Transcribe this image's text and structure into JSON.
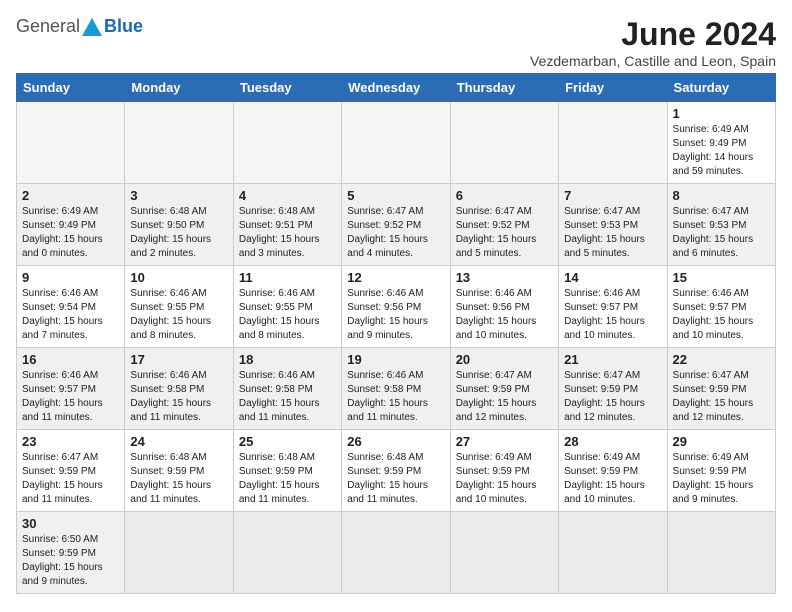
{
  "header": {
    "logo_general": "General",
    "logo_blue": "Blue",
    "month_title": "June 2024",
    "location": "Vezdemarban, Castille and Leon, Spain"
  },
  "weekdays": [
    "Sunday",
    "Monday",
    "Tuesday",
    "Wednesday",
    "Thursday",
    "Friday",
    "Saturday"
  ],
  "weeks": [
    [
      {
        "day": "",
        "info": ""
      },
      {
        "day": "",
        "info": ""
      },
      {
        "day": "",
        "info": ""
      },
      {
        "day": "",
        "info": ""
      },
      {
        "day": "",
        "info": ""
      },
      {
        "day": "",
        "info": ""
      },
      {
        "day": "1",
        "info": "Sunrise: 6:49 AM\nSunset: 9:49 PM\nDaylight: 14 hours\nand 59 minutes."
      }
    ],
    [
      {
        "day": "2",
        "info": "Sunrise: 6:49 AM\nSunset: 9:49 PM\nDaylight: 15 hours\nand 0 minutes."
      },
      {
        "day": "3",
        "info": "Sunrise: 6:48 AM\nSunset: 9:50 PM\nDaylight: 15 hours\nand 2 minutes."
      },
      {
        "day": "4",
        "info": "Sunrise: 6:48 AM\nSunset: 9:51 PM\nDaylight: 15 hours\nand 3 minutes."
      },
      {
        "day": "5",
        "info": "Sunrise: 6:47 AM\nSunset: 9:52 PM\nDaylight: 15 hours\nand 4 minutes."
      },
      {
        "day": "6",
        "info": "Sunrise: 6:47 AM\nSunset: 9:52 PM\nDaylight: 15 hours\nand 5 minutes."
      },
      {
        "day": "7",
        "info": "Sunrise: 6:47 AM\nSunset: 9:53 PM\nDaylight: 15 hours\nand 5 minutes."
      },
      {
        "day": "8",
        "info": "Sunrise: 6:47 AM\nSunset: 9:53 PM\nDaylight: 15 hours\nand 6 minutes."
      }
    ],
    [
      {
        "day": "9",
        "info": "Sunrise: 6:46 AM\nSunset: 9:54 PM\nDaylight: 15 hours\nand 7 minutes."
      },
      {
        "day": "10",
        "info": "Sunrise: 6:46 AM\nSunset: 9:55 PM\nDaylight: 15 hours\nand 8 minutes."
      },
      {
        "day": "11",
        "info": "Sunrise: 6:46 AM\nSunset: 9:55 PM\nDaylight: 15 hours\nand 8 minutes."
      },
      {
        "day": "12",
        "info": "Sunrise: 6:46 AM\nSunset: 9:56 PM\nDaylight: 15 hours\nand 9 minutes."
      },
      {
        "day": "13",
        "info": "Sunrise: 6:46 AM\nSunset: 9:56 PM\nDaylight: 15 hours\nand 10 minutes."
      },
      {
        "day": "14",
        "info": "Sunrise: 6:46 AM\nSunset: 9:57 PM\nDaylight: 15 hours\nand 10 minutes."
      },
      {
        "day": "15",
        "info": "Sunrise: 6:46 AM\nSunset: 9:57 PM\nDaylight: 15 hours\nand 10 minutes."
      }
    ],
    [
      {
        "day": "16",
        "info": "Sunrise: 6:46 AM\nSunset: 9:57 PM\nDaylight: 15 hours\nand 11 minutes."
      },
      {
        "day": "17",
        "info": "Sunrise: 6:46 AM\nSunset: 9:58 PM\nDaylight: 15 hours\nand 11 minutes."
      },
      {
        "day": "18",
        "info": "Sunrise: 6:46 AM\nSunset: 9:58 PM\nDaylight: 15 hours\nand 11 minutes."
      },
      {
        "day": "19",
        "info": "Sunrise: 6:46 AM\nSunset: 9:58 PM\nDaylight: 15 hours\nand 11 minutes."
      },
      {
        "day": "20",
        "info": "Sunrise: 6:47 AM\nSunset: 9:59 PM\nDaylight: 15 hours\nand 12 minutes."
      },
      {
        "day": "21",
        "info": "Sunrise: 6:47 AM\nSunset: 9:59 PM\nDaylight: 15 hours\nand 12 minutes."
      },
      {
        "day": "22",
        "info": "Sunrise: 6:47 AM\nSunset: 9:59 PM\nDaylight: 15 hours\nand 12 minutes."
      }
    ],
    [
      {
        "day": "23",
        "info": "Sunrise: 6:47 AM\nSunset: 9:59 PM\nDaylight: 15 hours\nand 11 minutes."
      },
      {
        "day": "24",
        "info": "Sunrise: 6:48 AM\nSunset: 9:59 PM\nDaylight: 15 hours\nand 11 minutes."
      },
      {
        "day": "25",
        "info": "Sunrise: 6:48 AM\nSunset: 9:59 PM\nDaylight: 15 hours\nand 11 minutes."
      },
      {
        "day": "26",
        "info": "Sunrise: 6:48 AM\nSunset: 9:59 PM\nDaylight: 15 hours\nand 11 minutes."
      },
      {
        "day": "27",
        "info": "Sunrise: 6:49 AM\nSunset: 9:59 PM\nDaylight: 15 hours\nand 10 minutes."
      },
      {
        "day": "28",
        "info": "Sunrise: 6:49 AM\nSunset: 9:59 PM\nDaylight: 15 hours\nand 10 minutes."
      },
      {
        "day": "29",
        "info": "Sunrise: 6:49 AM\nSunset: 9:59 PM\nDaylight: 15 hours\nand 9 minutes."
      }
    ],
    [
      {
        "day": "30",
        "info": "Sunrise: 6:50 AM\nSunset: 9:59 PM\nDaylight: 15 hours\nand 9 minutes."
      },
      {
        "day": "",
        "info": ""
      },
      {
        "day": "",
        "info": ""
      },
      {
        "day": "",
        "info": ""
      },
      {
        "day": "",
        "info": ""
      },
      {
        "day": "",
        "info": ""
      },
      {
        "day": "",
        "info": ""
      }
    ]
  ]
}
